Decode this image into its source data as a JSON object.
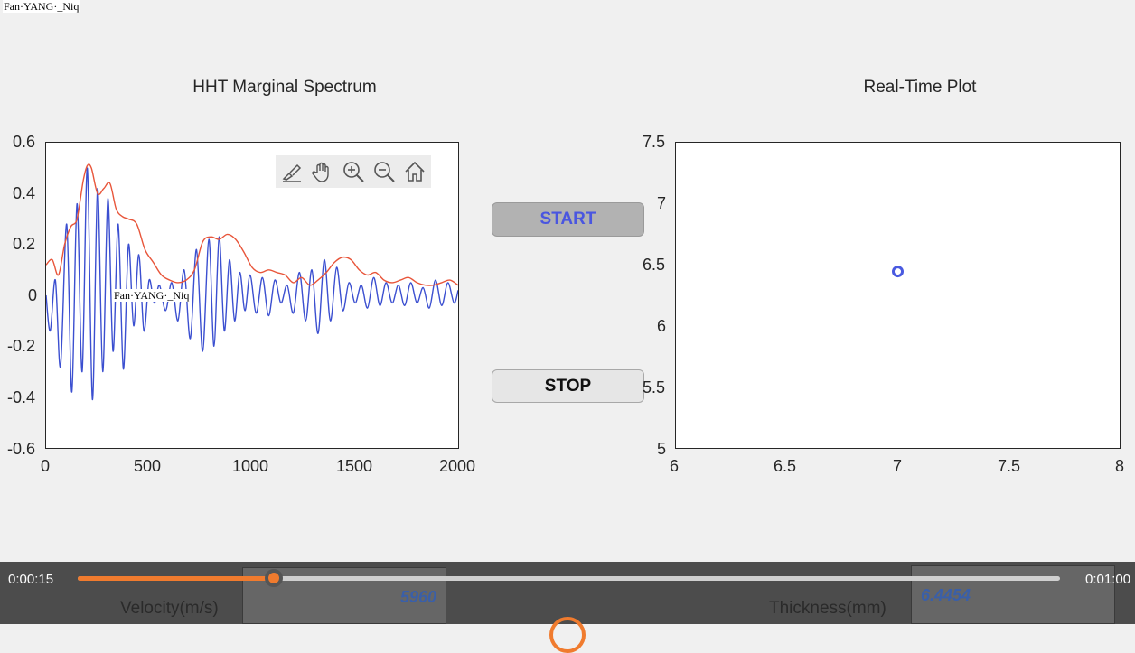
{
  "watermark": "Fan·YANG·_Niq",
  "left_plot": {
    "title": "HHT Marginal Spectrum",
    "x_ticks": [
      "0",
      "500",
      "1000",
      "1500",
      "2000"
    ],
    "y_ticks": [
      "0.6",
      "0.4",
      "0.2",
      "0",
      "-0.2",
      "-0.4",
      "-0.6"
    ],
    "toolbar_icons": [
      "brush-icon",
      "pan-hand-icon",
      "zoom-in-icon",
      "zoom-out-icon",
      "home-icon"
    ]
  },
  "right_plot": {
    "title": "Real-Time Plot",
    "x_ticks": [
      "6",
      "6.5",
      "7",
      "7.5",
      "8"
    ],
    "y_ticks": [
      "7.5",
      "7",
      "6.5",
      "6",
      "5.5",
      "5"
    ]
  },
  "chart_data": [
    {
      "type": "line",
      "title": "HHT Marginal Spectrum",
      "xlim": [
        0,
        2000
      ],
      "ylim": [
        -0.6,
        0.6
      ],
      "series": [
        {
          "color": "#3b4fd0",
          "x": [
            0,
            20,
            45,
            70,
            100,
            125,
            150,
            175,
            200,
            225,
            250,
            275,
            300,
            325,
            350,
            375,
            400,
            425,
            450,
            475,
            500,
            525,
            550,
            580,
            610,
            640,
            670,
            700,
            730,
            760,
            790,
            815,
            840,
            865,
            890,
            915,
            940,
            965,
            990,
            1020,
            1050,
            1080,
            1110,
            1140,
            1170,
            1200,
            1230,
            1260,
            1290,
            1320,
            1350,
            1380,
            1410,
            1440,
            1470,
            1500,
            1530,
            1560,
            1590,
            1620,
            1650,
            1680,
            1710,
            1740,
            1770,
            1800,
            1830,
            1860,
            1890,
            1920,
            1950,
            1980,
            2000
          ],
          "y": [
            0.0,
            -0.14,
            0.06,
            -0.28,
            0.28,
            -0.38,
            0.36,
            -0.3,
            0.5,
            -0.41,
            0.42,
            -0.3,
            0.38,
            -0.22,
            0.28,
            -0.29,
            0.2,
            -0.12,
            0.16,
            -0.14,
            0.06,
            -0.03,
            0.04,
            -0.06,
            0.05,
            -0.1,
            0.1,
            -0.17,
            0.18,
            -0.22,
            0.22,
            -0.2,
            0.23,
            -0.14,
            0.14,
            -0.1,
            0.09,
            -0.06,
            0.08,
            -0.07,
            0.07,
            -0.08,
            0.06,
            -0.03,
            0.04,
            -0.07,
            0.09,
            -0.1,
            0.1,
            -0.15,
            0.14,
            -0.1,
            0.11,
            -0.06,
            0.05,
            -0.03,
            0.04,
            -0.05,
            0.07,
            -0.04,
            0.05,
            -0.03,
            0.04,
            -0.04,
            0.05,
            -0.03,
            0.03,
            -0.05,
            0.06,
            -0.04,
            0.05,
            -0.03,
            0.02
          ]
        },
        {
          "color": "#e8553a",
          "x": [
            0,
            30,
            60,
            90,
            120,
            150,
            180,
            200,
            220,
            250,
            280,
            310,
            340,
            370,
            400,
            440,
            480,
            520,
            560,
            600,
            640,
            680,
            720,
            760,
            800,
            840,
            880,
            920,
            960,
            1000,
            1040,
            1080,
            1120,
            1160,
            1200,
            1240,
            1280,
            1320,
            1360,
            1400,
            1440,
            1480,
            1520,
            1560,
            1600,
            1640,
            1680,
            1720,
            1760,
            1800,
            1840,
            1880,
            1920,
            1960,
            2000
          ],
          "y": [
            0.12,
            0.14,
            0.08,
            0.2,
            0.27,
            0.3,
            0.45,
            0.51,
            0.5,
            0.4,
            0.42,
            0.44,
            0.34,
            0.31,
            0.3,
            0.28,
            0.18,
            0.13,
            0.08,
            0.06,
            0.05,
            0.06,
            0.1,
            0.21,
            0.23,
            0.22,
            0.24,
            0.22,
            0.17,
            0.11,
            0.09,
            0.1,
            0.09,
            0.08,
            0.05,
            0.07,
            0.04,
            0.06,
            0.09,
            0.13,
            0.15,
            0.14,
            0.1,
            0.08,
            0.09,
            0.06,
            0.05,
            0.06,
            0.07,
            0.05,
            0.04,
            0.04,
            0.05,
            0.06,
            0.04
          ]
        }
      ]
    },
    {
      "type": "scatter",
      "title": "Real-Time Plot",
      "xlim": [
        6,
        8
      ],
      "ylim": [
        5,
        7.5
      ],
      "series": [
        {
          "color": "#4a5ae0",
          "x": [
            7.0
          ],
          "y": [
            6.4454
          ]
        }
      ]
    }
  ],
  "buttons": {
    "start": "START",
    "stop": "STOP"
  },
  "fields": {
    "velocity_label": "Velocity(m/s)",
    "velocity_value": "5960",
    "thickness_label": "Thickness(mm)",
    "thickness_value": "6.4454"
  },
  "player": {
    "current_time": "0:00:15",
    "total_time": "0:01:00",
    "progress": 0.2,
    "accent": "#f07b2e"
  }
}
